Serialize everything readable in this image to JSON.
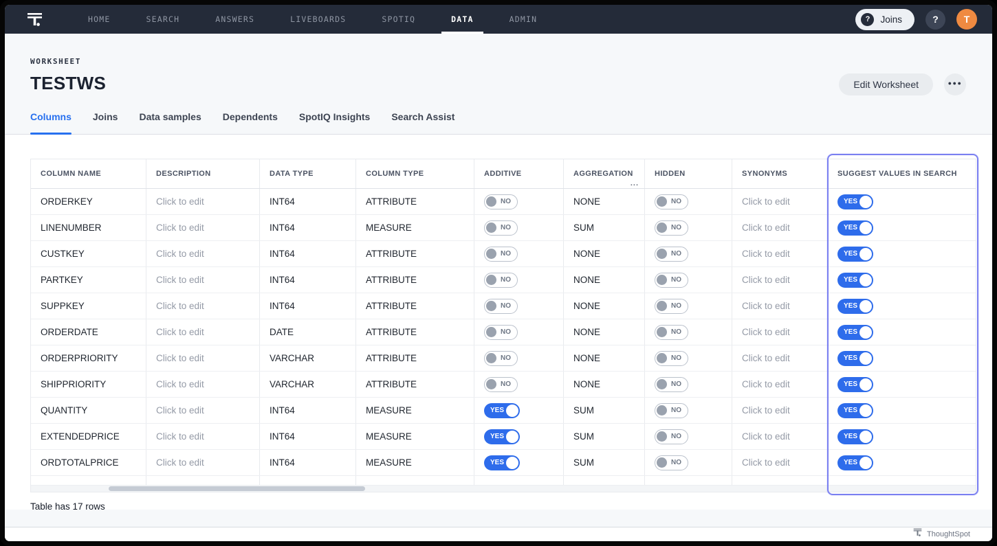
{
  "nav": {
    "items": [
      "HOME",
      "SEARCH",
      "ANSWERS",
      "LIVEBOARDS",
      "SPOTIQ",
      "DATA",
      "ADMIN"
    ],
    "active_item": "DATA",
    "joins_button_label": "Joins",
    "joins_icon_glyph": "?",
    "help_icon_glyph": "?",
    "avatar_initial": "T"
  },
  "header": {
    "eyebrow": "WORKSHEET",
    "title": "TESTWS",
    "edit_button_label": "Edit Worksheet",
    "more_button_label": "●●●"
  },
  "tabs": [
    {
      "label": "Columns",
      "active": true
    },
    {
      "label": "Joins",
      "active": false
    },
    {
      "label": "Data samples",
      "active": false
    },
    {
      "label": "Dependents",
      "active": false
    },
    {
      "label": "SpotIQ Insights",
      "active": false
    },
    {
      "label": "Search Assist",
      "active": false
    }
  ],
  "table": {
    "columns": [
      "COLUMN NAME",
      "DESCRIPTION",
      "DATA TYPE",
      "COLUMN TYPE",
      "ADDITIVE",
      "AGGREGATION",
      "HIDDEN",
      "SYNONYMS",
      "SUGGEST VALUES IN SEARCH"
    ],
    "aggregation_overflow": "...",
    "rows": [
      {
        "name": "ORDERKEY",
        "description": "Click to edit",
        "data_type": "INT64",
        "column_type": "ATTRIBUTE",
        "additive": "NO",
        "aggregation": "NONE",
        "hidden": "NO",
        "synonyms": "Click to edit",
        "suggest": "YES"
      },
      {
        "name": "LINENUMBER",
        "description": "Click to edit",
        "data_type": "INT64",
        "column_type": "MEASURE",
        "additive": "NO",
        "aggregation": "SUM",
        "hidden": "NO",
        "synonyms": "Click to edit",
        "suggest": "YES"
      },
      {
        "name": "CUSTKEY",
        "description": "Click to edit",
        "data_type": "INT64",
        "column_type": "ATTRIBUTE",
        "additive": "NO",
        "aggregation": "NONE",
        "hidden": "NO",
        "synonyms": "Click to edit",
        "suggest": "YES"
      },
      {
        "name": "PARTKEY",
        "description": "Click to edit",
        "data_type": "INT64",
        "column_type": "ATTRIBUTE",
        "additive": "NO",
        "aggregation": "NONE",
        "hidden": "NO",
        "synonyms": "Click to edit",
        "suggest": "YES"
      },
      {
        "name": "SUPPKEY",
        "description": "Click to edit",
        "data_type": "INT64",
        "column_type": "ATTRIBUTE",
        "additive": "NO",
        "aggregation": "NONE",
        "hidden": "NO",
        "synonyms": "Click to edit",
        "suggest": "YES"
      },
      {
        "name": "ORDERDATE",
        "description": "Click to edit",
        "data_type": "DATE",
        "column_type": "ATTRIBUTE",
        "additive": "NO",
        "aggregation": "NONE",
        "hidden": "NO",
        "synonyms": "Click to edit",
        "suggest": "YES"
      },
      {
        "name": "ORDERPRIORITY",
        "description": "Click to edit",
        "data_type": "VARCHAR",
        "column_type": "ATTRIBUTE",
        "additive": "NO",
        "aggregation": "NONE",
        "hidden": "NO",
        "synonyms": "Click to edit",
        "suggest": "YES"
      },
      {
        "name": "SHIPPRIORITY",
        "description": "Click to edit",
        "data_type": "VARCHAR",
        "column_type": "ATTRIBUTE",
        "additive": "NO",
        "aggregation": "NONE",
        "hidden": "NO",
        "synonyms": "Click to edit",
        "suggest": "YES"
      },
      {
        "name": "QUANTITY",
        "description": "Click to edit",
        "data_type": "INT64",
        "column_type": "MEASURE",
        "additive": "YES",
        "aggregation": "SUM",
        "hidden": "NO",
        "synonyms": "Click to edit",
        "suggest": "YES"
      },
      {
        "name": "EXTENDEDPRICE",
        "description": "Click to edit",
        "data_type": "INT64",
        "column_type": "MEASURE",
        "additive": "YES",
        "aggregation": "SUM",
        "hidden": "NO",
        "synonyms": "Click to edit",
        "suggest": "YES"
      },
      {
        "name": "ORDTOTALPRICE",
        "description": "Click to edit",
        "data_type": "INT64",
        "column_type": "MEASURE",
        "additive": "YES",
        "aggregation": "SUM",
        "hidden": "NO",
        "synonyms": "Click to edit",
        "suggest": "YES"
      }
    ],
    "footer_note": "Table has 17 rows"
  },
  "footer": {
    "brand": "ThoughtSpot"
  },
  "colors": {
    "nav_bg": "#242b39",
    "accent_blue": "#2770ef",
    "toggle_yes_blue": "#2e6ceb",
    "highlight_purple": "#7a7ff1",
    "avatar_orange": "#ef8a41",
    "page_bg": "#f6f8fa"
  }
}
